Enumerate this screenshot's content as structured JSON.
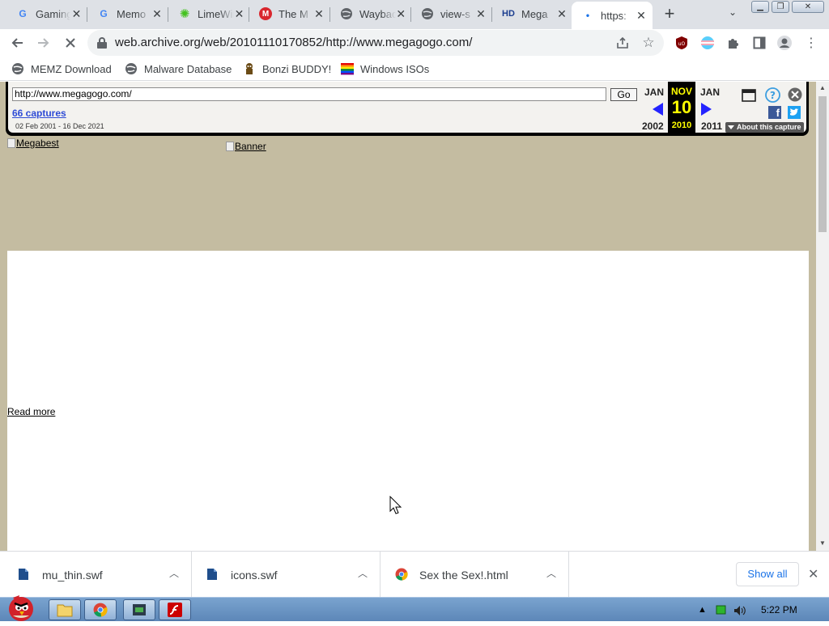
{
  "tabs": [
    {
      "title": "Gaming",
      "icon": "google-icon"
    },
    {
      "title": "Memo",
      "icon": "google-icon"
    },
    {
      "title": "LimeWire",
      "icon": "limewire-icon"
    },
    {
      "title": "The M",
      "icon": "mega-icon"
    },
    {
      "title": "Wayback",
      "icon": "globe-icon"
    },
    {
      "title": "view-s",
      "icon": "globe-icon"
    },
    {
      "title": "Mega",
      "icon": "hd-icon"
    },
    {
      "title": "https:",
      "icon": "loading-icon",
      "active": true
    }
  ],
  "address_bar": {
    "url": "web.archive.org/web/20101110170852/http://www.megagogo.com/"
  },
  "bookmarks": [
    {
      "label": "MEMZ Download",
      "icon": "globe-icon"
    },
    {
      "label": "Malware Database",
      "icon": "globe-icon"
    },
    {
      "label": "Bonzi BUDDY!",
      "icon": "bonzi-icon"
    },
    {
      "label": "Windows ISOs",
      "icon": "windows-flag-icon"
    }
  ],
  "wayback": {
    "url_value": "http://www.megagogo.com/",
    "go_label": "Go",
    "captures_link": "66 captures",
    "date_range": "02 Feb 2001 - 16 Dec 2021",
    "prev_month": "JAN",
    "prev_year": "2002",
    "current_month": "NOV",
    "current_day": "10",
    "current_year": "2010",
    "next_month": "JAN",
    "next_year": "2011",
    "about_label": "About this capture"
  },
  "page": {
    "megabest_alt": "Megabest",
    "banner_alt": "Banner",
    "read_more": "Read more"
  },
  "downloads": [
    {
      "name": "mu_thin.swf",
      "icon": "file-icon"
    },
    {
      "name": "icons.swf",
      "icon": "file-icon"
    },
    {
      "name": "Sex the Sex!.html",
      "icon": "chrome-icon"
    }
  ],
  "show_all_label": "Show all",
  "taskbar": {
    "time": "5:22 PM"
  },
  "colors": {
    "page_background": "#c4bca1",
    "wayback_highlight": "#ffff00",
    "captures_link": "#2e4bd6"
  }
}
